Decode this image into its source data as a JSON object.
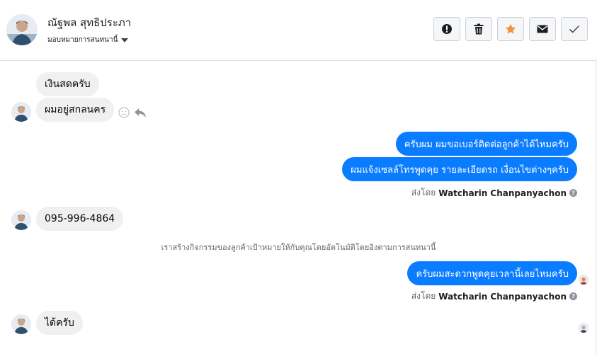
{
  "header": {
    "contact_name": "ณัฐพล สุทธิประภา",
    "assign_label": "มอบหมายการสนทนานี้",
    "actions": [
      {
        "name": "alert-icon"
      },
      {
        "name": "trash-icon"
      },
      {
        "name": "star-icon",
        "color": "#f7923a"
      },
      {
        "name": "envelope-icon"
      },
      {
        "name": "check-icon"
      }
    ]
  },
  "messages": {
    "m1": "เงินสดครับ",
    "m2": "ผมอยู่สกลนคร",
    "m3": "ครับผม ผมขอเบอร์ติดต่อลูกค้าได้ไหมครับ",
    "m4": "ผมแจ้งเซลล์โทรพูดคุย รายละเอียดรถ เงื่อนไขต่างๆครับ",
    "m5": "095-996-4864",
    "m6": "ครับผมสะดวกพูดคุยเวลานี้เลยไหมครับ",
    "m7": "ได้ครับ"
  },
  "sent_by": {
    "prefix": "ส่งโดย",
    "name": "Watcharin Chanpanyachon"
  },
  "system_notice": "เราสร้างกิจกรรมของลูกค้าเป้าหมายให้กับคุณโดยอัตโนมัติโดยอิงตามการสนทนานี้",
  "colors": {
    "outgoing_bubble": "#0a7cff",
    "incoming_bubble": "#f0f0f0"
  }
}
